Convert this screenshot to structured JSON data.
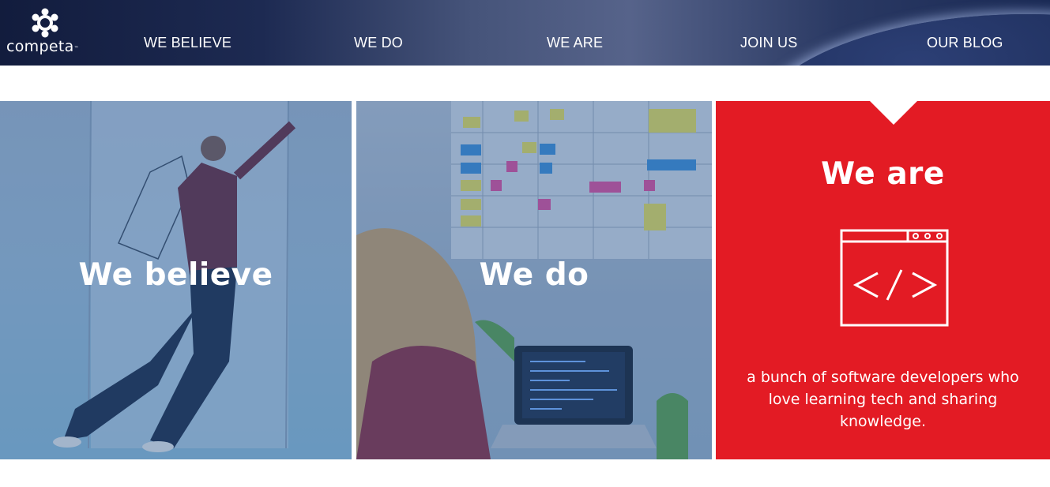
{
  "header": {
    "logo_text": "competa",
    "nav": [
      {
        "label": "WE BELIEVE"
      },
      {
        "label": "WE DO"
      },
      {
        "label": "WE ARE"
      },
      {
        "label": "JOIN US"
      },
      {
        "label": "OUR BLOG"
      }
    ]
  },
  "panels": {
    "believe": {
      "title": "We believe"
    },
    "do": {
      "title": "We do"
    },
    "are": {
      "title": "We are",
      "description": "a bunch of software developers who love learning tech and sharing knowledge."
    }
  },
  "icons": {
    "logo": "competa-logo-icon",
    "code_window": "code-window-icon"
  },
  "colors": {
    "accent_red": "#e31b24",
    "nav_bg": "#1d2a52",
    "photo_overlay": "#2355a0"
  }
}
